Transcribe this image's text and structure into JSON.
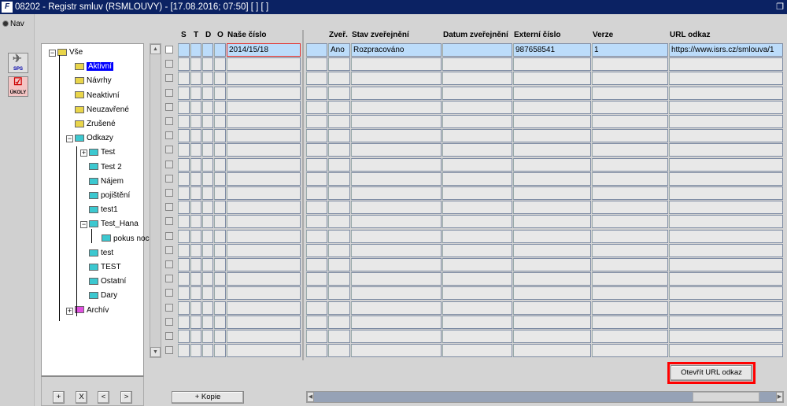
{
  "window": {
    "title": "08202 - Registr smluv (RSMLOUVY) - [17.08.2016; 07:50]  [ ]  [ ]",
    "logo": "F"
  },
  "leftbar": {
    "nav_label": "Nav",
    "tools": [
      {
        "label": "SPS",
        "icon": "paper-plane-icon"
      },
      {
        "label": "ÚKOLY",
        "icon": "checklist-icon"
      }
    ]
  },
  "tree": {
    "nodes": [
      {
        "label": "Vše",
        "color": "yellow",
        "level": 0,
        "expanded": true
      },
      {
        "label": "Aktivní",
        "color": "yellow",
        "level": 1,
        "selected": true
      },
      {
        "label": "Návrhy",
        "color": "yellow",
        "level": 1
      },
      {
        "label": "Neaktivní",
        "color": "yellow",
        "level": 1
      },
      {
        "label": "Neuzavřené",
        "color": "yellow",
        "level": 1
      },
      {
        "label": "Zrušené",
        "color": "yellow",
        "level": 1
      },
      {
        "label": "Odkazy",
        "color": "cyan",
        "level": 1,
        "expanded": true
      },
      {
        "label": "Test",
        "color": "cyan",
        "level": 2,
        "collapsed": true
      },
      {
        "label": "Test 2",
        "color": "cyan",
        "level": 2
      },
      {
        "label": "Nájem",
        "color": "cyan",
        "level": 2
      },
      {
        "label": "pojištění",
        "color": "cyan",
        "level": 2
      },
      {
        "label": "test1",
        "color": "cyan",
        "level": 2
      },
      {
        "label": "Test_Hana",
        "color": "cyan",
        "level": 2,
        "expanded": true
      },
      {
        "label": "pokus noc",
        "color": "cyan",
        "level": 3
      },
      {
        "label": "test",
        "color": "cyan",
        "level": 2
      },
      {
        "label": "TEST",
        "color": "cyan",
        "level": 2
      },
      {
        "label": "Ostatní",
        "color": "cyan",
        "level": 2
      },
      {
        "label": "Dary",
        "color": "cyan",
        "level": 2
      },
      {
        "label": "Archív",
        "color": "pink",
        "level": 1,
        "collapsed": true
      }
    ],
    "buttons": [
      "+",
      "X",
      "<",
      ">"
    ]
  },
  "grid": {
    "headers": {
      "s": "S",
      "t": "T",
      "d": "D",
      "o": "O",
      "nase": "Naše číslo",
      "zver": "Zveř.",
      "stav": "Stav zveřejnění",
      "datum": "Datum zveřejnění",
      "ext": "Externí číslo",
      "verze": "Verze",
      "url": "URL odkaz"
    },
    "row_count": 22,
    "rows": [
      {
        "nase": "2014/15/18",
        "zver": "Ano",
        "stav": "Rozpracováno",
        "datum": "",
        "ext": "987658541",
        "verze": "1",
        "url": "https://www.isrs.cz/smlouva/1"
      }
    ]
  },
  "buttons": {
    "kopie": "+ Kopie",
    "open_url": "Otevřít URL odkaz"
  },
  "colors": {
    "titlebar": "#0b2263",
    "active_row": "#bcdcfa",
    "highlight": "#ff0000"
  }
}
